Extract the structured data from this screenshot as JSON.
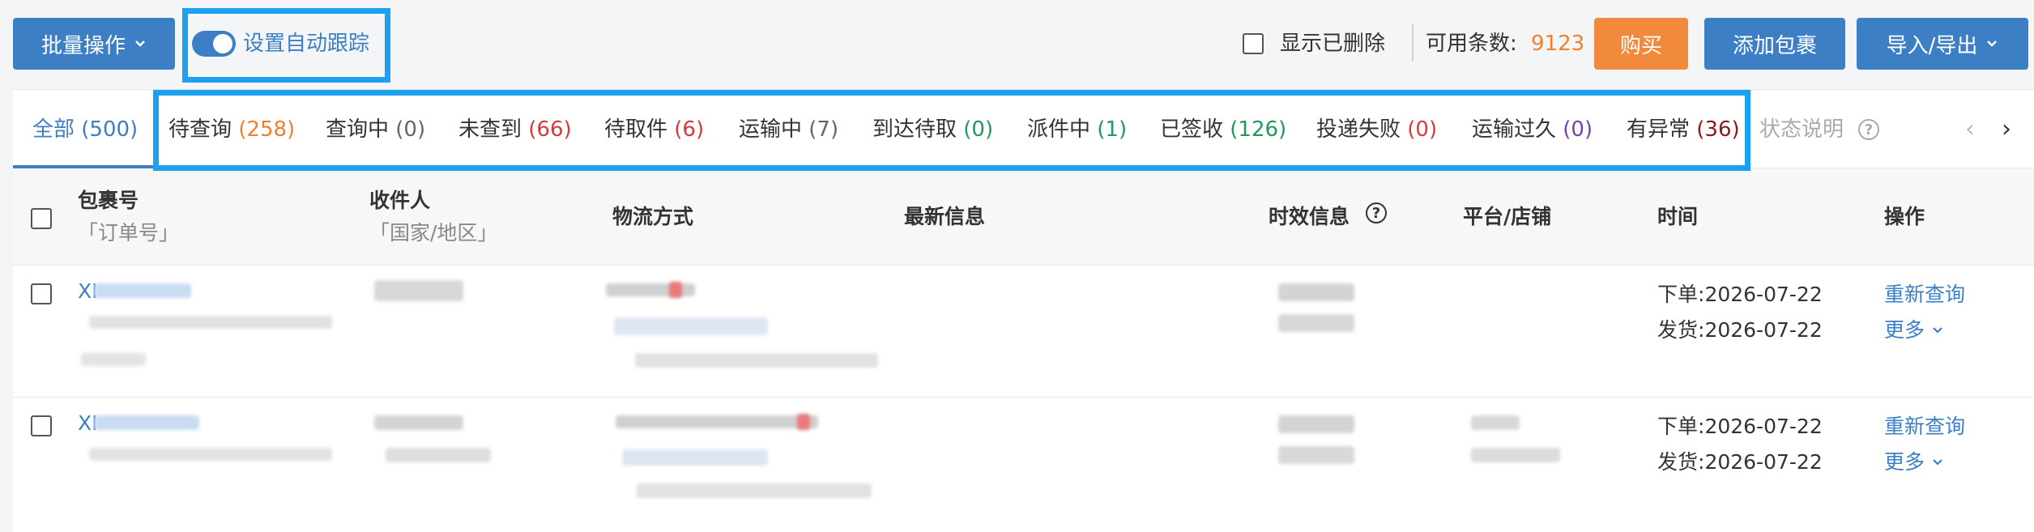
{
  "toolbar": {
    "batch_label": "批量操作",
    "auto_track_label": "设置自动跟踪",
    "show_deleted_label": "显示已删除",
    "available_label": "可用条数:",
    "available_count": "9123",
    "buy_label": "购买",
    "add_package_label": "添加包裹",
    "import_export_label": "导入/导出"
  },
  "tabs": [
    {
      "label": "全部",
      "count": "(500)"
    },
    {
      "label": "待查询",
      "count": "(258)"
    },
    {
      "label": "查询中",
      "count": "(0)"
    },
    {
      "label": "未查到",
      "count": "(66)"
    },
    {
      "label": "待取件",
      "count": "(6)"
    },
    {
      "label": "运输中",
      "count": "(7)"
    },
    {
      "label": "到达待取",
      "count": "(0)"
    },
    {
      "label": "派件中",
      "count": "(1)"
    },
    {
      "label": "已签收",
      "count": "(126)"
    },
    {
      "label": "投递失败",
      "count": "(0)"
    },
    {
      "label": "运输过久",
      "count": "(0)"
    },
    {
      "label": "有异常",
      "count": "(36)"
    }
  ],
  "status_note": "状态说明",
  "table": {
    "headers": {
      "package_no": "包裹号",
      "order_no": "「订单号」",
      "recipient": "收件人",
      "country": "「国家/地区」",
      "logistics": "物流方式",
      "latest_info": "最新信息",
      "timeliness": "时效信息",
      "platform": "平台/店铺",
      "time": "时间",
      "action": "操作"
    },
    "rows": [
      {
        "package_prefix": "XI",
        "order_label": "下单:",
        "order_date": "2026-07-22",
        "ship_label": "发货:",
        "ship_date": "2026-07-22",
        "requery": "重新查询",
        "more": "更多"
      },
      {
        "package_prefix": "XI",
        "order_label": "下单:",
        "order_date": "2026-07-22",
        "ship_label": "发货:",
        "ship_date": "2026-07-22",
        "requery": "重新查询",
        "more": "更多"
      }
    ]
  }
}
